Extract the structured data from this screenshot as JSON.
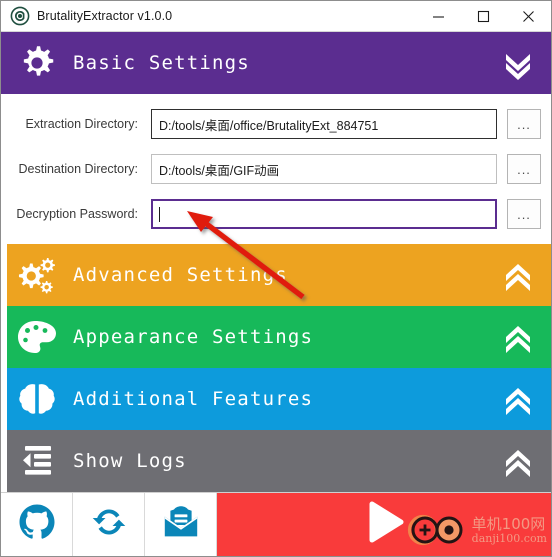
{
  "window": {
    "title": "BrutalityExtractor v1.0.0",
    "app_icon": "app-logo-icon",
    "controls": {
      "minimize": "—",
      "maximize": "☐",
      "close": "✕"
    }
  },
  "sections": [
    {
      "id": "basic-settings",
      "label": "Basic Settings",
      "color": "#5b2d90",
      "icon": "gear-icon",
      "chevron": "chevron-double-down-icon",
      "expanded": true
    },
    {
      "id": "advanced-settings",
      "label": "Advanced Settings",
      "color": "#eda320",
      "icon": "cogs-icon",
      "chevron": "chevron-double-up-icon",
      "expanded": false
    },
    {
      "id": "appearance-settings",
      "label": "Appearance Settings",
      "color": "#17b95a",
      "icon": "palette-icon",
      "chevron": "chevron-double-up-icon",
      "expanded": false
    },
    {
      "id": "additional-features",
      "label": "Additional Features",
      "color": "#0d9bdc",
      "icon": "brain-icon",
      "chevron": "chevron-double-up-icon",
      "expanded": false
    },
    {
      "id": "show-logs",
      "label": "Show Logs",
      "color": "#6e6e73",
      "icon": "indent-decrease-icon",
      "chevron": "chevron-double-up-icon",
      "expanded": false
    }
  ],
  "basic_form": {
    "rows": [
      {
        "label": "Extraction Directory:",
        "value": "D:/tools/桌面/office/BrutalityExt_884751",
        "placeholder": "",
        "browse_label": "...",
        "focused": false,
        "emphasized": true
      },
      {
        "label": "Destination Directory:",
        "value": "D:/tools/桌面/GIF动画",
        "placeholder": "",
        "browse_label": "...",
        "focused": false,
        "emphasized": false
      },
      {
        "label": "Decryption Password:",
        "value": "",
        "placeholder": "",
        "browse_label": "...",
        "focused": true,
        "emphasized": false
      }
    ]
  },
  "toolbar": {
    "buttons": [
      {
        "id": "github",
        "icon": "github-icon",
        "label": ""
      },
      {
        "id": "update",
        "icon": "sync-refresh-icon",
        "label": ""
      },
      {
        "id": "feedback",
        "icon": "envelope-document-icon",
        "label": ""
      }
    ],
    "start": {
      "id": "start",
      "icon": "play-triangle-icon",
      "label": "",
      "color": "#f93b3b"
    }
  },
  "watermark": {
    "icon": "danji100-logo-icon",
    "chinese": "单机100网",
    "domain": "danji100.com"
  },
  "annotation": {
    "type": "arrow",
    "color": "#e01b10",
    "target": "decryption-password-field"
  }
}
